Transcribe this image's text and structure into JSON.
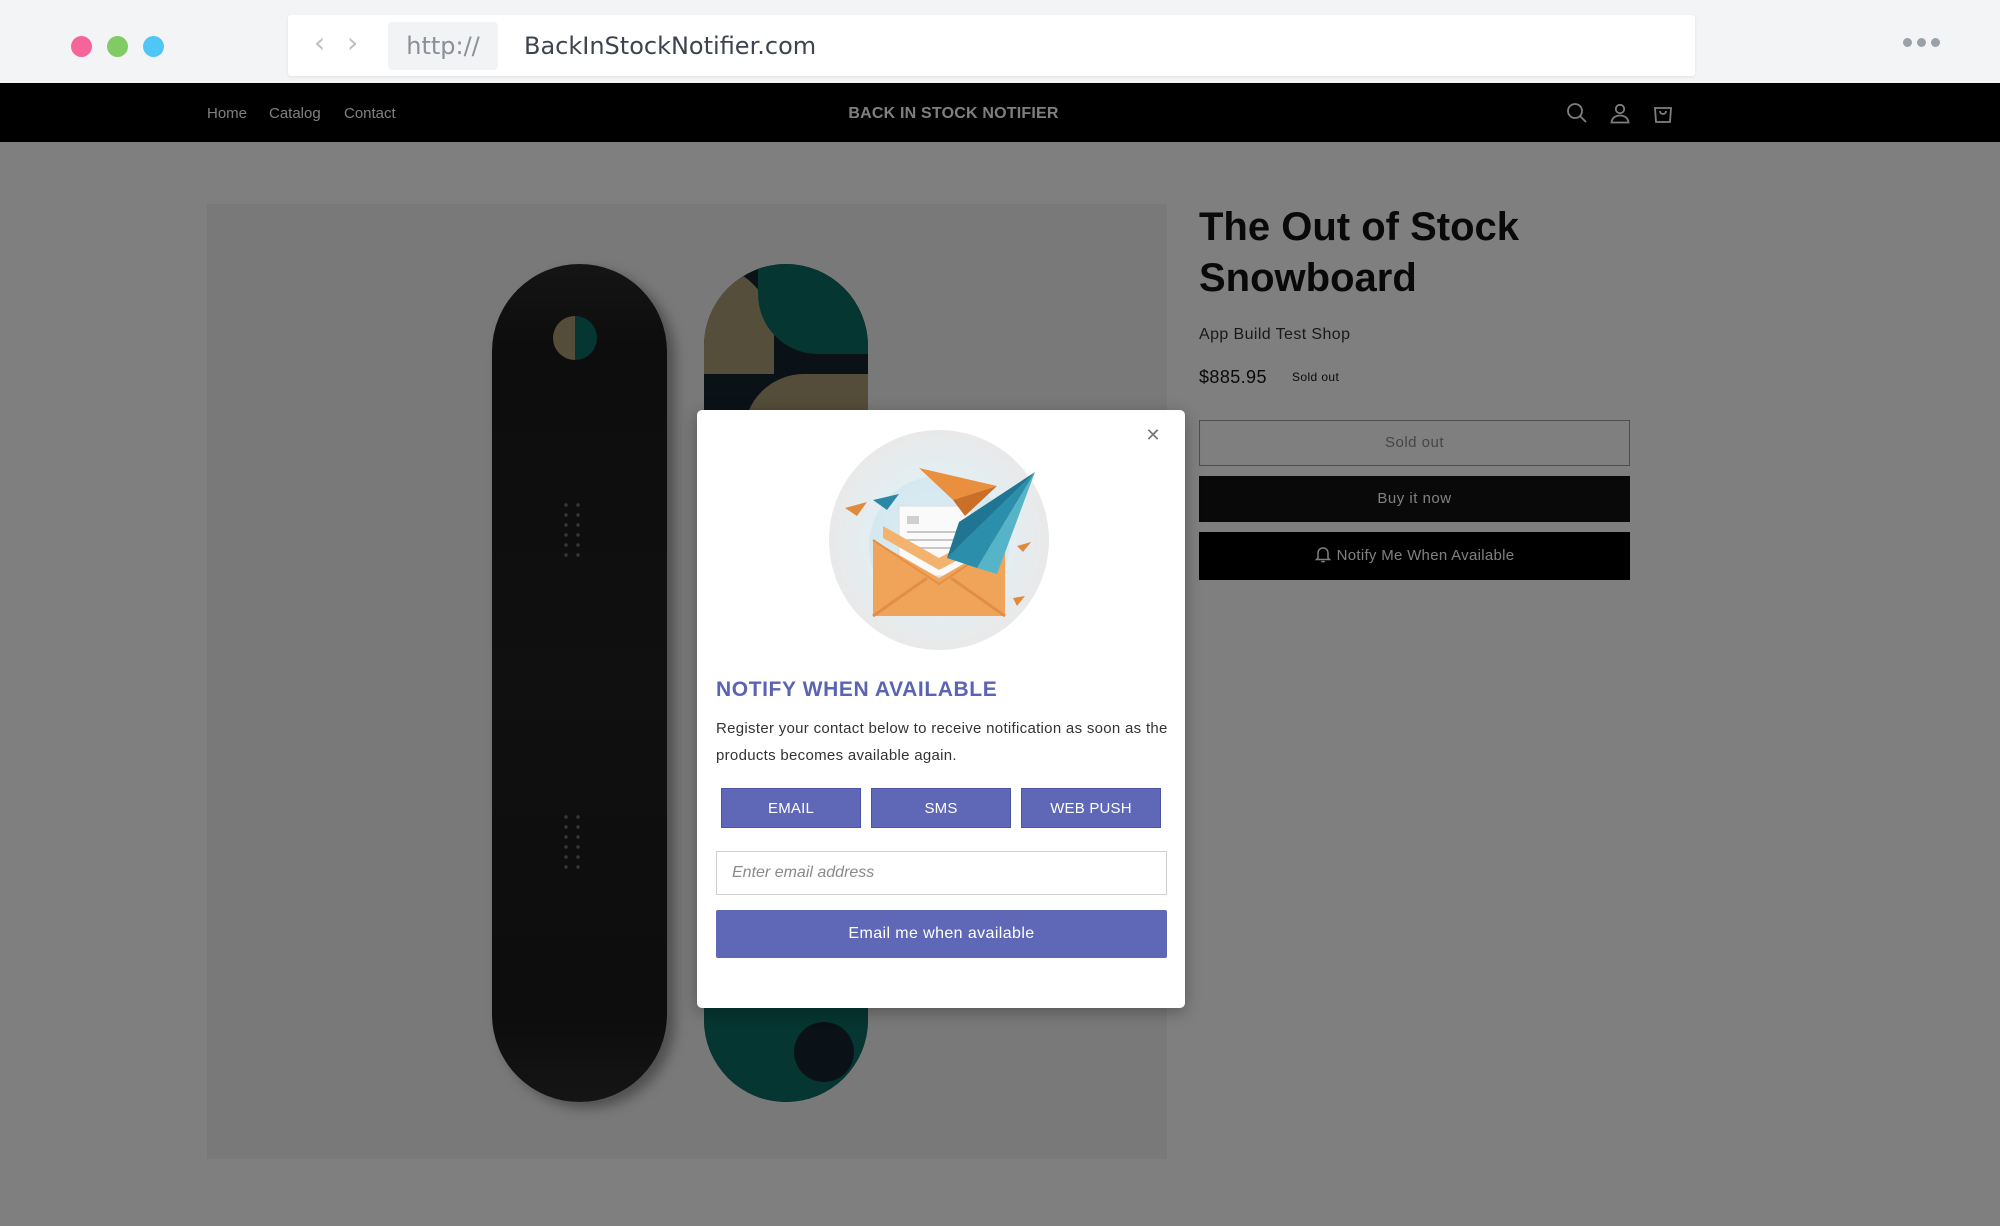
{
  "browser": {
    "protocol": "http://",
    "url": "BackInStockNotifier.com",
    "back_icon": "chevron-left-icon",
    "forward_icon": "chevron-right-icon",
    "more_icon": "more-dots-icon",
    "window_dots": [
      "#f7649a",
      "#80cb63",
      "#4fc6f5"
    ]
  },
  "header": {
    "nav": [
      "Home",
      "Catalog",
      "Contact"
    ],
    "brand": "BACK IN STOCK NOTIFIER",
    "icons": [
      "search-icon",
      "account-icon",
      "cart-icon"
    ]
  },
  "product": {
    "title": "The Out of Stock Snowboard",
    "vendor": "App Build Test Shop",
    "price": "$885.95",
    "badge": "Sold out",
    "sold_out_button": "Sold out",
    "buy_button": "Buy it now",
    "notify_button": "Notify Me When Available"
  },
  "modal": {
    "title": "NOTIFY WHEN AVAILABLE",
    "description": "Register your contact below to receive notification as soon as the products becomes available again.",
    "channels": [
      "EMAIL",
      "SMS",
      "WEB PUSH"
    ],
    "email_placeholder": "Enter email address",
    "email_value": "",
    "submit": "Email me when available",
    "close_icon": "close-icon",
    "accent_color": "#5f68b6"
  }
}
